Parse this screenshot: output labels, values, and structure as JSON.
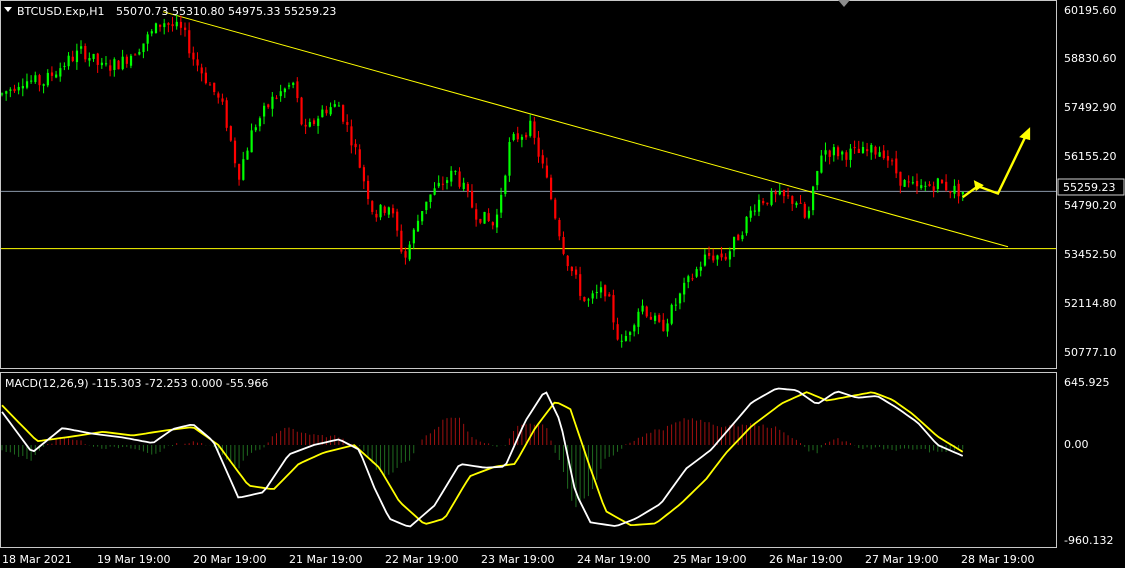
{
  "colors": {
    "background": "#000000",
    "grid": "#ffffff",
    "bull_candle": "#00ff00",
    "bear_candle": "#ff0000",
    "trendline": "#ffff00",
    "support_line": "#ffff00",
    "current_price_line": "#8a97a8",
    "macd_line": "#ffffff",
    "signal_line": "#ffff00",
    "hist_positive": "#a01010",
    "hist_negative": "#1f6b1f",
    "price_tag_bg": "#000000",
    "price_tag_border": "#c0c0c0",
    "arrow": "#ffff00"
  },
  "header": {
    "symbol": "BTCUSD.Exp,H1",
    "ohlc": "55070.73 55310.80 54975.33 55259.23"
  },
  "price_axis": {
    "ticks": [
      "60195.60",
      "58830.60",
      "57492.90",
      "56155.20",
      "54790.20",
      "53452.50",
      "52114.80",
      "50777.10"
    ],
    "current_price": "55259.23"
  },
  "macd": {
    "title": "MACD(12,26,9) -115.303 -72.253 0.000 -55.966",
    "ticks": [
      "645.925",
      "0.00",
      "-960.132"
    ]
  },
  "time_axis": {
    "labels": [
      "18 Mar 2021",
      "19 Mar 19:00",
      "20 Mar 19:00",
      "21 Mar 19:00",
      "22 Mar 19:00",
      "23 Mar 19:00",
      "24 Mar 19:00",
      "25 Mar 19:00",
      "26 Mar 19:00",
      "27 Mar 19:00",
      "28 Mar 19:00"
    ]
  },
  "chart_data": [
    {
      "type": "candlestick",
      "title": "BTCUSD.Exp,H1",
      "ylim": [
        50300,
        60500
      ],
      "close_path": [
        {
          "t": 0,
          "price": 57900
        },
        {
          "t": 0.02,
          "price": 58300
        },
        {
          "t": 0.04,
          "price": 58200
        },
        {
          "t": 0.06,
          "price": 58700
        },
        {
          "t": 0.08,
          "price": 59100
        },
        {
          "t": 0.1,
          "price": 58600
        },
        {
          "t": 0.12,
          "price": 58800
        },
        {
          "t": 0.14,
          "price": 59300
        },
        {
          "t": 0.16,
          "price": 59900
        },
        {
          "t": 0.18,
          "price": 59600
        },
        {
          "t": 0.19,
          "price": 58900
        },
        {
          "t": 0.21,
          "price": 58000
        },
        {
          "t": 0.22,
          "price": 57500
        },
        {
          "t": 0.235,
          "price": 55700
        },
        {
          "t": 0.25,
          "price": 57000
        },
        {
          "t": 0.27,
          "price": 57800
        },
        {
          "t": 0.29,
          "price": 58200
        },
        {
          "t": 0.3,
          "price": 56800
        },
        {
          "t": 0.32,
          "price": 57500
        },
        {
          "t": 0.335,
          "price": 57600
        },
        {
          "t": 0.35,
          "price": 56500
        },
        {
          "t": 0.37,
          "price": 54600
        },
        {
          "t": 0.385,
          "price": 54900
        },
        {
          "t": 0.4,
          "price": 53400
        },
        {
          "t": 0.42,
          "price": 55000
        },
        {
          "t": 0.45,
          "price": 55800
        },
        {
          "t": 0.47,
          "price": 54700
        },
        {
          "t": 0.49,
          "price": 54300
        },
        {
          "t": 0.505,
          "price": 56600
        },
        {
          "t": 0.525,
          "price": 57000
        },
        {
          "t": 0.54,
          "price": 55700
        },
        {
          "t": 0.56,
          "price": 53500
        },
        {
          "t": 0.58,
          "price": 52200
        },
        {
          "t": 0.6,
          "price": 52600
        },
        {
          "t": 0.615,
          "price": 51000
        },
        {
          "t": 0.635,
          "price": 52200
        },
        {
          "t": 0.655,
          "price": 51500
        },
        {
          "t": 0.68,
          "price": 52700
        },
        {
          "t": 0.7,
          "price": 53500
        },
        {
          "t": 0.72,
          "price": 53500
        },
        {
          "t": 0.735,
          "price": 54200
        },
        {
          "t": 0.75,
          "price": 55000
        },
        {
          "t": 0.77,
          "price": 55100
        },
        {
          "t": 0.79,
          "price": 55000
        },
        {
          "t": 0.8,
          "price": 54400
        },
        {
          "t": 0.815,
          "price": 56400
        },
        {
          "t": 0.835,
          "price": 56300
        },
        {
          "t": 0.855,
          "price": 56300
        },
        {
          "t": 0.875,
          "price": 56400
        },
        {
          "t": 0.895,
          "price": 55500
        },
        {
          "t": 0.91,
          "price": 55300
        },
        {
          "t": 0.93,
          "price": 55500
        },
        {
          "t": 0.945,
          "price": 55300
        },
        {
          "t": 0.955,
          "price": 55259
        }
      ],
      "trendline": [
        {
          "t": 0.16,
          "price": 60150
        },
        {
          "t": 1.0,
          "price": 53750
        }
      ],
      "support_level": 53700,
      "projection_arrows": [
        {
          "t": 0.955,
          "price": 55100
        },
        {
          "t": 0.97,
          "price": 55400
        },
        {
          "t": 0.99,
          "price": 55200
        },
        {
          "t": 1.02,
          "price": 56900
        }
      ]
    },
    {
      "type": "line",
      "title": "MACD(12,26,9) -115.303 -72.253 0.000 -55.966",
      "ylim": [
        -960.132,
        645.925
      ],
      "series": [
        {
          "role": "macd",
          "points": [
            {
              "t": 0,
              "v": 350
            },
            {
              "t": 0.03,
              "v": -80
            },
            {
              "t": 0.06,
              "v": 180
            },
            {
              "t": 0.09,
              "v": 120
            },
            {
              "t": 0.12,
              "v": 80
            },
            {
              "t": 0.15,
              "v": 20
            },
            {
              "t": 0.17,
              "v": 170
            },
            {
              "t": 0.19,
              "v": 220
            },
            {
              "t": 0.21,
              "v": 40
            },
            {
              "t": 0.235,
              "v": -560
            },
            {
              "t": 0.26,
              "v": -500
            },
            {
              "t": 0.285,
              "v": -100
            },
            {
              "t": 0.31,
              "v": 0
            },
            {
              "t": 0.335,
              "v": 60
            },
            {
              "t": 0.355,
              "v": -50
            },
            {
              "t": 0.37,
              "v": -450
            },
            {
              "t": 0.385,
              "v": -780
            },
            {
              "t": 0.405,
              "v": -870
            },
            {
              "t": 0.43,
              "v": -640
            },
            {
              "t": 0.455,
              "v": -200
            },
            {
              "t": 0.48,
              "v": -240
            },
            {
              "t": 0.5,
              "v": -230
            },
            {
              "t": 0.52,
              "v": 250
            },
            {
              "t": 0.54,
              "v": 580
            },
            {
              "t": 0.555,
              "v": 250
            },
            {
              "t": 0.57,
              "v": -500
            },
            {
              "t": 0.585,
              "v": -820
            },
            {
              "t": 0.61,
              "v": -860
            },
            {
              "t": 0.63,
              "v": -780
            },
            {
              "t": 0.655,
              "v": -620
            },
            {
              "t": 0.68,
              "v": -250
            },
            {
              "t": 0.705,
              "v": -50
            },
            {
              "t": 0.725,
              "v": 200
            },
            {
              "t": 0.745,
              "v": 450
            },
            {
              "t": 0.77,
              "v": 600
            },
            {
              "t": 0.79,
              "v": 580
            },
            {
              "t": 0.81,
              "v": 430
            },
            {
              "t": 0.83,
              "v": 570
            },
            {
              "t": 0.85,
              "v": 500
            },
            {
              "t": 0.87,
              "v": 520
            },
            {
              "t": 0.89,
              "v": 390
            },
            {
              "t": 0.91,
              "v": 240
            },
            {
              "t": 0.93,
              "v": 0
            },
            {
              "t": 0.955,
              "v": -115
            }
          ]
        },
        {
          "role": "signal",
          "points": [
            {
              "t": 0,
              "v": 420
            },
            {
              "t": 0.035,
              "v": 40
            },
            {
              "t": 0.07,
              "v": 90
            },
            {
              "t": 0.1,
              "v": 140
            },
            {
              "t": 0.13,
              "v": 100
            },
            {
              "t": 0.16,
              "v": 150
            },
            {
              "t": 0.19,
              "v": 190
            },
            {
              "t": 0.215,
              "v": 0
            },
            {
              "t": 0.245,
              "v": -430
            },
            {
              "t": 0.27,
              "v": -470
            },
            {
              "t": 0.295,
              "v": -200
            },
            {
              "t": 0.32,
              "v": -80
            },
            {
              "t": 0.35,
              "v": 0
            },
            {
              "t": 0.375,
              "v": -240
            },
            {
              "t": 0.395,
              "v": -600
            },
            {
              "t": 0.42,
              "v": -840
            },
            {
              "t": 0.44,
              "v": -780
            },
            {
              "t": 0.465,
              "v": -330
            },
            {
              "t": 0.49,
              "v": -230
            },
            {
              "t": 0.51,
              "v": -200
            },
            {
              "t": 0.53,
              "v": 180
            },
            {
              "t": 0.55,
              "v": 460
            },
            {
              "t": 0.565,
              "v": 380
            },
            {
              "t": 0.585,
              "v": -250
            },
            {
              "t": 0.6,
              "v": -700
            },
            {
              "t": 0.625,
              "v": -850
            },
            {
              "t": 0.65,
              "v": -830
            },
            {
              "t": 0.675,
              "v": -620
            },
            {
              "t": 0.7,
              "v": -360
            },
            {
              "t": 0.72,
              "v": -80
            },
            {
              "t": 0.745,
              "v": 200
            },
            {
              "t": 0.775,
              "v": 440
            },
            {
              "t": 0.8,
              "v": 560
            },
            {
              "t": 0.82,
              "v": 470
            },
            {
              "t": 0.845,
              "v": 520
            },
            {
              "t": 0.865,
              "v": 560
            },
            {
              "t": 0.885,
              "v": 480
            },
            {
              "t": 0.905,
              "v": 330
            },
            {
              "t": 0.93,
              "v": 90
            },
            {
              "t": 0.955,
              "v": -72
            }
          ]
        }
      ]
    }
  ]
}
